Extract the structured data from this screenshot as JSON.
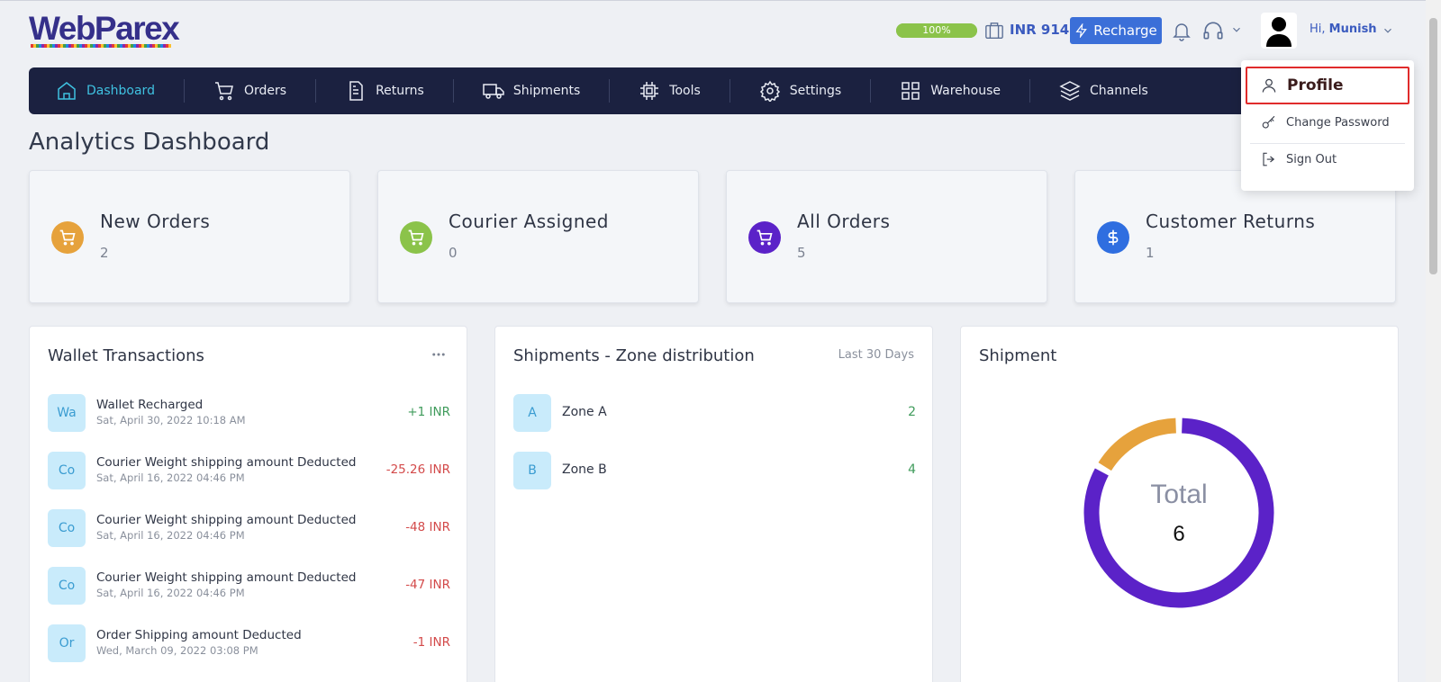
{
  "brand": {
    "name": "WebParex"
  },
  "header": {
    "progress_percent": 100,
    "progress_label": "100%",
    "wallet_amount": "INR 914",
    "recharge_label": "Recharge",
    "greeting_prefix": "Hi,",
    "user_name": "Munish"
  },
  "nav": {
    "items": [
      {
        "label": "Dashboard",
        "icon": "home-icon",
        "active": true
      },
      {
        "label": "Orders",
        "icon": "cart-icon"
      },
      {
        "label": "Returns",
        "icon": "document-icon"
      },
      {
        "label": "Shipments",
        "icon": "truck-icon"
      },
      {
        "label": "Tools",
        "icon": "chip-icon"
      },
      {
        "label": "Settings",
        "icon": "gear-icon"
      },
      {
        "label": "Warehouse",
        "icon": "grid-icon"
      },
      {
        "label": "Channels",
        "icon": "layers-icon"
      }
    ]
  },
  "page_title": "Analytics Dashboard",
  "stats": [
    {
      "title": "New Orders",
      "value": "2",
      "color": "#e6a23c",
      "icon": "cart-icon"
    },
    {
      "title": "Courier Assigned",
      "value": "0",
      "color": "#8bc34a",
      "icon": "cart-icon"
    },
    {
      "title": "All Orders",
      "value": "5",
      "color": "#5b22c8",
      "icon": "cart-icon"
    },
    {
      "title": "Customer Returns",
      "value": "1",
      "color": "#2f6ee0",
      "icon": "dollar-icon"
    }
  ],
  "wallet": {
    "title": "Wallet Transactions",
    "transactions": [
      {
        "badge": "Wa",
        "title": "Wallet Recharged",
        "date": "Sat, April 30, 2022 10:18 AM",
        "amount": "+1 INR",
        "type": "credit"
      },
      {
        "badge": "Co",
        "title": "Courier Weight shipping amount Deducted",
        "date": "Sat, April 16, 2022 04:46 PM",
        "amount": "-25.26 INR",
        "type": "debit"
      },
      {
        "badge": "Co",
        "title": "Courier Weight shipping amount Deducted",
        "date": "Sat, April 16, 2022 04:46 PM",
        "amount": "-48 INR",
        "type": "debit"
      },
      {
        "badge": "Co",
        "title": "Courier Weight shipping amount Deducted",
        "date": "Sat, April 16, 2022 04:46 PM",
        "amount": "-47 INR",
        "type": "debit"
      },
      {
        "badge": "Or",
        "title": "Order Shipping amount Deducted",
        "date": "Wed, March 09, 2022 03:08 PM",
        "amount": "-1 INR",
        "type": "debit"
      }
    ]
  },
  "zones": {
    "title": "Shipments - Zone distribution",
    "period": "Last 30 Days",
    "items": [
      {
        "badge": "A",
        "name": "Zone A",
        "count": "2"
      },
      {
        "badge": "B",
        "name": "Zone B",
        "count": "4"
      }
    ]
  },
  "shipment": {
    "title": "Shipment",
    "center_label": "Total",
    "total": "6"
  },
  "chart_data": {
    "type": "pie",
    "categories": [
      "",
      ""
    ],
    "values": [
      1,
      5
    ],
    "colors": [
      "#e6a23c",
      "#5b22c8"
    ],
    "title": "Shipment",
    "center_text": "Total",
    "total": 6
  },
  "user_menu": {
    "items": [
      {
        "label": "Profile",
        "icon": "user-icon"
      },
      {
        "label": "Change Password",
        "icon": "key-icon"
      },
      {
        "label": "Sign Out",
        "icon": "logout-icon"
      }
    ]
  }
}
